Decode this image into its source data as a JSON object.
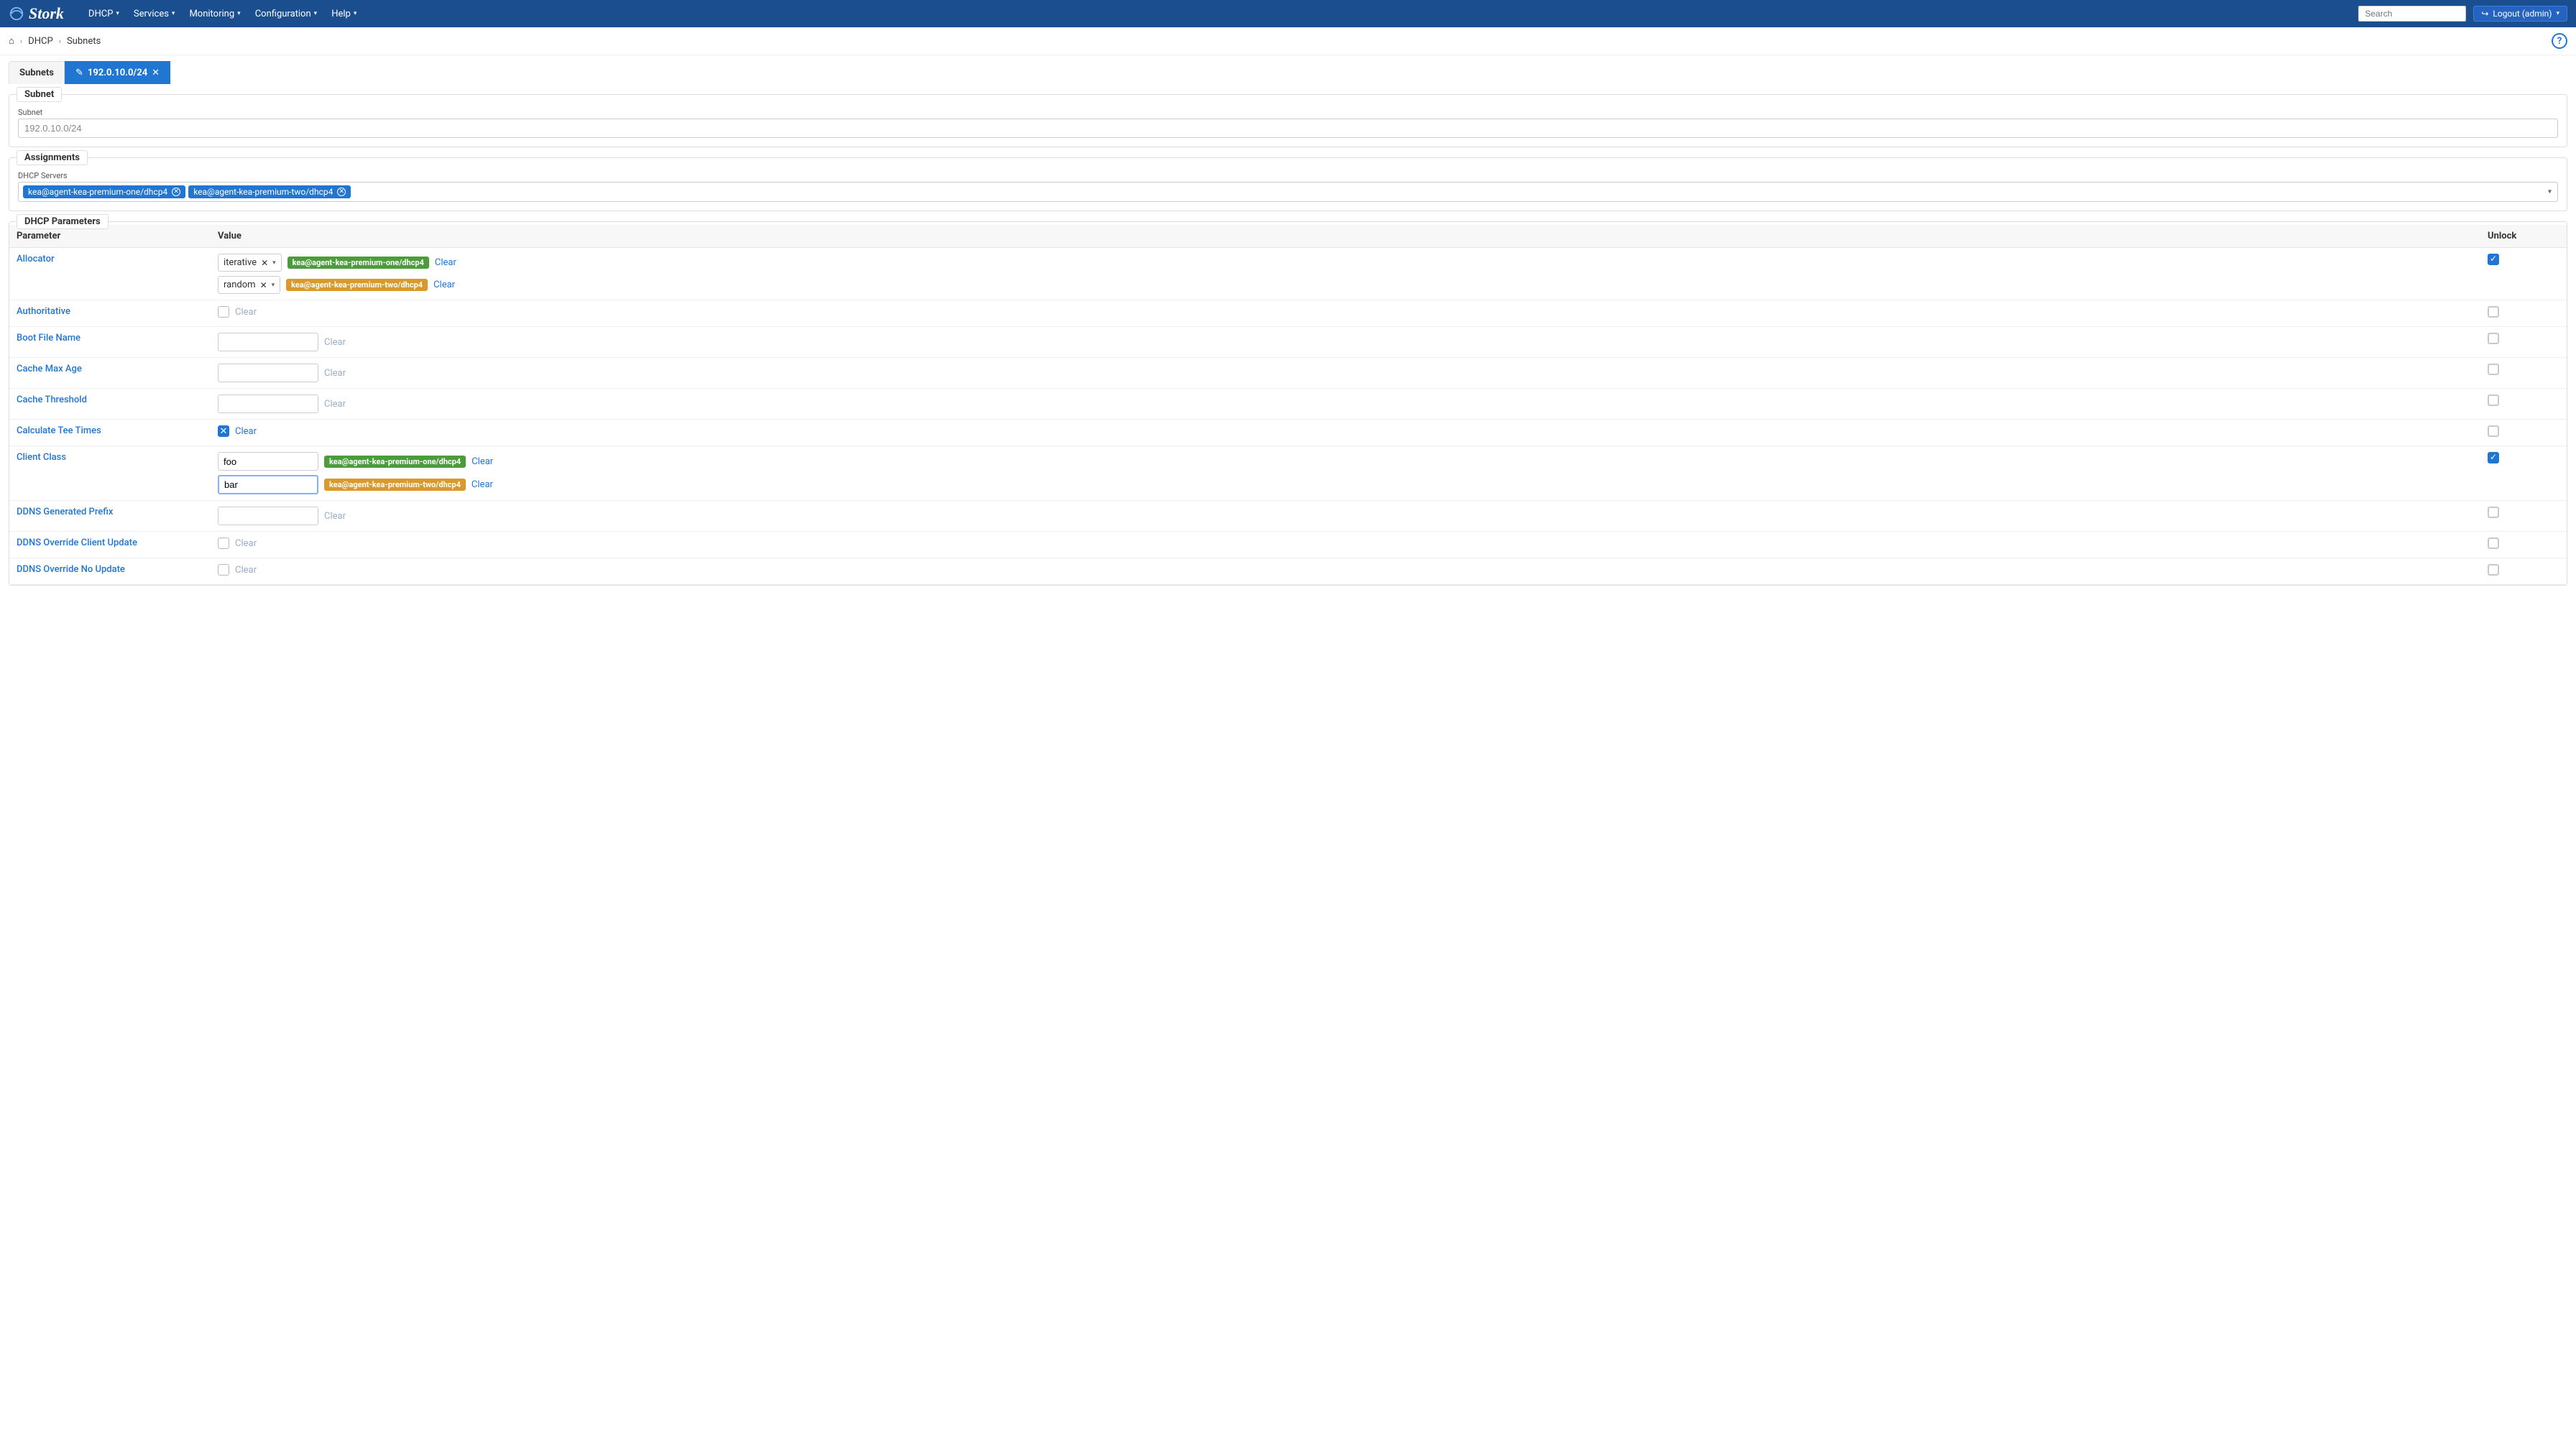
{
  "navbar": {
    "title": "Stork",
    "items": [
      "DHCP",
      "Services",
      "Monitoring",
      "Configuration",
      "Help"
    ],
    "search_placeholder": "Search",
    "logout_label": "Logout (admin)"
  },
  "breadcrumb": {
    "items": [
      "DHCP",
      "Subnets"
    ]
  },
  "tabs": {
    "list_label": "Subnets",
    "active_label": "192.0.10.0/24"
  },
  "panel_subnet": {
    "legend": "Subnet",
    "field_label": "Subnet",
    "value": "192.0.10.0/24"
  },
  "panel_assignments": {
    "legend": "Assignments",
    "field_label": "DHCP Servers",
    "servers": [
      "kea@agent-kea-premium-one/dhcp4",
      "kea@agent-kea-premium-two/dhcp4"
    ]
  },
  "panel_params": {
    "legend": "DHCP Parameters",
    "columns": {
      "parameter": "Parameter",
      "value": "Value",
      "unlock": "Unlock"
    },
    "badges": {
      "one": "kea@agent-kea-premium-one/dhcp4",
      "two": "kea@agent-kea-premium-two/dhcp4"
    },
    "clear": "Clear",
    "rows": {
      "allocator": {
        "label": "Allocator",
        "v1": "iterative",
        "v2": "random"
      },
      "authoritative": {
        "label": "Authoritative"
      },
      "boot_file_name": {
        "label": "Boot File Name"
      },
      "cache_max_age": {
        "label": "Cache Max Age"
      },
      "cache_threshold": {
        "label": "Cache Threshold"
      },
      "calculate_tee_times": {
        "label": "Calculate Tee Times"
      },
      "client_class": {
        "label": "Client Class",
        "v1": "foo",
        "v2": "bar"
      },
      "ddns_generated_prefix": {
        "label": "DDNS Generated Prefix"
      },
      "ddns_override_client_update": {
        "label": "DDNS Override Client Update"
      },
      "ddns_override_no_update": {
        "label": "DDNS Override No Update"
      }
    }
  }
}
